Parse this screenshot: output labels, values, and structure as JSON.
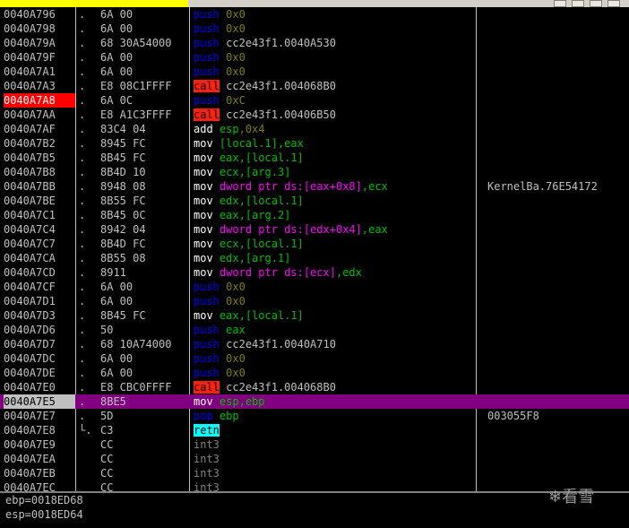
{
  "rows": [
    {
      "addr": "0040A796",
      "mark": ".",
      "hex": "6A 00",
      "op": "push",
      "args": [
        {
          "t": "imm",
          "v": "0x0"
        }
      ],
      "comment": ""
    },
    {
      "addr": "0040A798",
      "mark": ".",
      "hex": "6A 00",
      "op": "push",
      "args": [
        {
          "t": "imm",
          "v": "0x0"
        }
      ],
      "comment": ""
    },
    {
      "addr": "0040A79A",
      "mark": ".",
      "hex": "68 30A54000",
      "op": "push",
      "args": [
        {
          "t": "sym",
          "v": "cc2e43f1.0040A530"
        }
      ],
      "comment": ""
    },
    {
      "addr": "0040A79F",
      "mark": ".",
      "hex": "6A 00",
      "op": "push",
      "args": [
        {
          "t": "imm",
          "v": "0x0"
        }
      ],
      "comment": ""
    },
    {
      "addr": "0040A7A1",
      "mark": ".",
      "hex": "6A 00",
      "op": "push",
      "args": [
        {
          "t": "imm",
          "v": "0x0"
        }
      ],
      "comment": ""
    },
    {
      "addr": "0040A7A3",
      "mark": ".",
      "hex": "E8 08C1FFFF",
      "op": "call",
      "args": [
        {
          "t": "sym",
          "v": "cc2e43f1.004068B0"
        }
      ],
      "comment": ""
    },
    {
      "addr": "0040A7A8",
      "mark": ".",
      "hex": "6A 0C",
      "op": "push",
      "args": [
        {
          "t": "imm",
          "v": "0xC"
        }
      ],
      "comment": "",
      "bp": true
    },
    {
      "addr": "0040A7AA",
      "mark": ".",
      "hex": "E8 A1C3FFFF",
      "op": "call",
      "args": [
        {
          "t": "sym",
          "v": "cc2e43f1.00406B50"
        }
      ],
      "comment": ""
    },
    {
      "addr": "0040A7AF",
      "mark": ".",
      "hex": "83C4 04",
      "op": "add",
      "args": [
        {
          "t": "reg",
          "v": "esp"
        },
        {
          "t": "imm",
          "v": ",0x4"
        }
      ],
      "comment": ""
    },
    {
      "addr": "0040A7B2",
      "mark": ".",
      "hex": "8945 FC",
      "op": "mov",
      "args": [
        {
          "t": "reg",
          "v": "[local.1],eax"
        }
      ],
      "comment": ""
    },
    {
      "addr": "0040A7B5",
      "mark": ".",
      "hex": "8B45 FC",
      "op": "mov",
      "args": [
        {
          "t": "reg",
          "v": "eax,[local.1]"
        }
      ],
      "comment": ""
    },
    {
      "addr": "0040A7B8",
      "mark": ".",
      "hex": "8B4D 10",
      "op": "mov",
      "args": [
        {
          "t": "reg",
          "v": "ecx,[arg.3]"
        }
      ],
      "comment": ""
    },
    {
      "addr": "0040A7BB",
      "mark": ".",
      "hex": "8948 08",
      "op": "mov",
      "args": [
        {
          "t": "mem",
          "v": "dword ptr ds:[eax+0x8]"
        },
        {
          "t": "reg",
          "v": ",ecx"
        }
      ],
      "comment": "KernelBa.76E54172"
    },
    {
      "addr": "0040A7BE",
      "mark": ".",
      "hex": "8B55 FC",
      "op": "mov",
      "args": [
        {
          "t": "reg",
          "v": "edx,[local.1]"
        }
      ],
      "comment": ""
    },
    {
      "addr": "0040A7C1",
      "mark": ".",
      "hex": "8B45 0C",
      "op": "mov",
      "args": [
        {
          "t": "reg",
          "v": "eax,[arg.2]"
        }
      ],
      "comment": ""
    },
    {
      "addr": "0040A7C4",
      "mark": ".",
      "hex": "8942 04",
      "op": "mov",
      "args": [
        {
          "t": "mem",
          "v": "dword ptr ds:[edx+0x4]"
        },
        {
          "t": "reg",
          "v": ",eax"
        }
      ],
      "comment": ""
    },
    {
      "addr": "0040A7C7",
      "mark": ".",
      "hex": "8B4D FC",
      "op": "mov",
      "args": [
        {
          "t": "reg",
          "v": "ecx,[local.1]"
        }
      ],
      "comment": ""
    },
    {
      "addr": "0040A7CA",
      "mark": ".",
      "hex": "8B55 08",
      "op": "mov",
      "args": [
        {
          "t": "reg",
          "v": "edx,[arg.1]"
        }
      ],
      "comment": ""
    },
    {
      "addr": "0040A7CD",
      "mark": ".",
      "hex": "8911",
      "op": "mov",
      "args": [
        {
          "t": "mem",
          "v": "dword ptr ds:[ecx]"
        },
        {
          "t": "reg",
          "v": ",edx"
        }
      ],
      "comment": ""
    },
    {
      "addr": "0040A7CF",
      "mark": ".",
      "hex": "6A 00",
      "op": "push",
      "args": [
        {
          "t": "imm",
          "v": "0x0"
        }
      ],
      "comment": ""
    },
    {
      "addr": "0040A7D1",
      "mark": ".",
      "hex": "6A 00",
      "op": "push",
      "args": [
        {
          "t": "imm",
          "v": "0x0"
        }
      ],
      "comment": ""
    },
    {
      "addr": "0040A7D3",
      "mark": ".",
      "hex": "8B45 FC",
      "op": "mov",
      "args": [
        {
          "t": "reg",
          "v": "eax,[local.1]"
        }
      ],
      "comment": ""
    },
    {
      "addr": "0040A7D6",
      "mark": ".",
      "hex": "50",
      "op": "push",
      "args": [
        {
          "t": "reg",
          "v": "eax"
        }
      ],
      "comment": ""
    },
    {
      "addr": "0040A7D7",
      "mark": ".",
      "hex": "68 10A74000",
      "op": "push",
      "args": [
        {
          "t": "sym",
          "v": "cc2e43f1.0040A710"
        }
      ],
      "comment": ""
    },
    {
      "addr": "0040A7DC",
      "mark": ".",
      "hex": "6A 00",
      "op": "push",
      "args": [
        {
          "t": "imm",
          "v": "0x0"
        }
      ],
      "comment": ""
    },
    {
      "addr": "0040A7DE",
      "mark": ".",
      "hex": "6A 00",
      "op": "push",
      "args": [
        {
          "t": "imm",
          "v": "0x0"
        }
      ],
      "comment": ""
    },
    {
      "addr": "0040A7E0",
      "mark": ".",
      "hex": "E8 CBC0FFFF",
      "op": "call",
      "args": [
        {
          "t": "sym",
          "v": "cc2e43f1.004068B0"
        }
      ],
      "comment": ""
    },
    {
      "addr": "0040A7E5",
      "mark": ".",
      "hex": "8BE5",
      "op": "mov",
      "args": [
        {
          "t": "reg",
          "v": "esp,ebp"
        }
      ],
      "comment": "",
      "cur": true
    },
    {
      "addr": "0040A7E7",
      "mark": ".",
      "hex": "5D",
      "op": "pop",
      "args": [
        {
          "t": "reg",
          "v": "ebp"
        }
      ],
      "comment": "003055F8"
    },
    {
      "addr": "0040A7E8",
      "mark": "└.",
      "hex": "C3",
      "op": "retn",
      "args": [],
      "comment": ""
    },
    {
      "addr": "0040A7E9",
      "mark": "",
      "hex": "CC",
      "op": "int3",
      "args": [],
      "comment": ""
    },
    {
      "addr": "0040A7EA",
      "mark": "",
      "hex": "CC",
      "op": "int3",
      "args": [],
      "comment": ""
    },
    {
      "addr": "0040A7EB",
      "mark": "",
      "hex": "CC",
      "op": "int3",
      "args": [],
      "comment": ""
    },
    {
      "addr": "0040A7EC",
      "mark": "",
      "hex": "CC",
      "op": "int3",
      "args": [],
      "comment": ""
    }
  ],
  "info": {
    "line1": "ebp=0018ED68",
    "line2": "esp=0018ED64"
  },
  "watermark": "看雪"
}
